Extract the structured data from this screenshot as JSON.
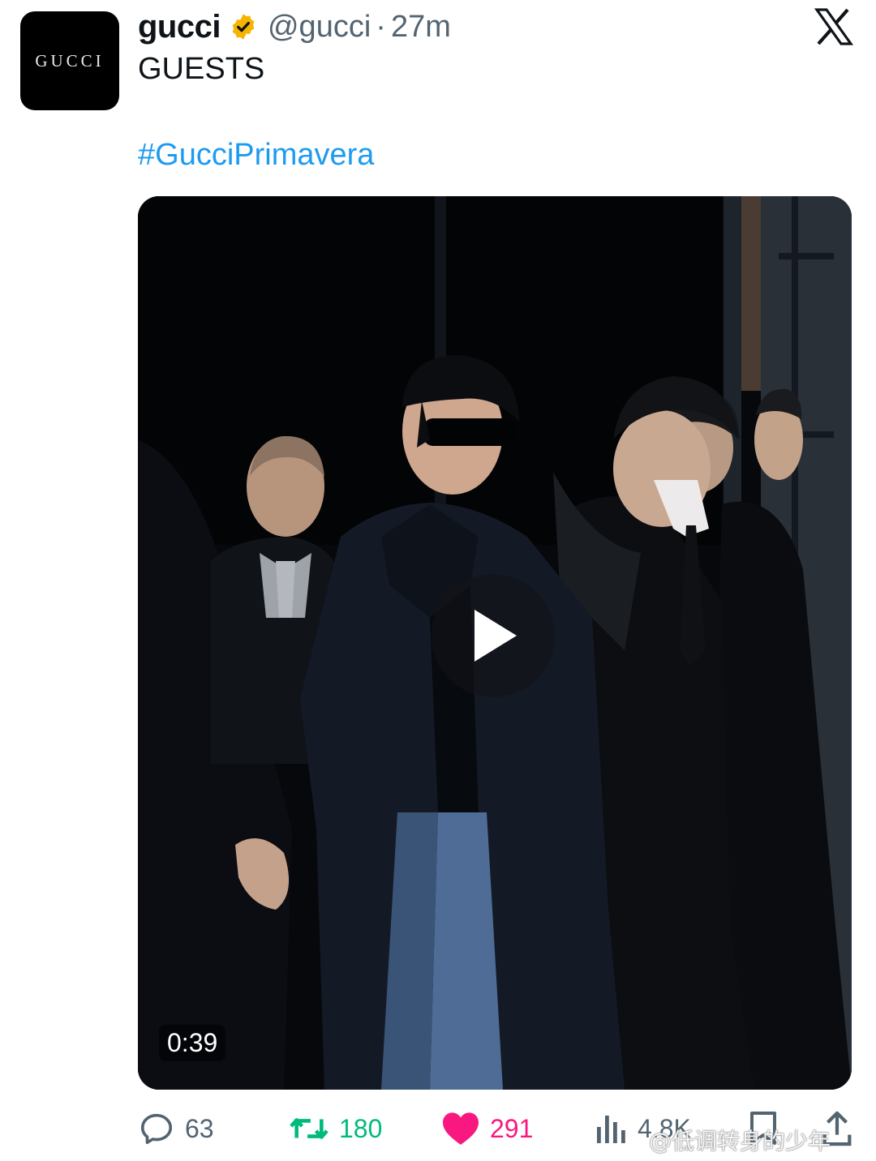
{
  "account": {
    "avatar_text": "GUCCI",
    "display_name": "gucci",
    "handle": "@gucci",
    "separator": "·",
    "time": "27m",
    "verified_icon": "verified-badge-icon",
    "verified_color": "#f4b400"
  },
  "platform_icon": "x-logo-icon",
  "tweet": {
    "text": "GUESTS",
    "hashtag": "#GucciPrimavera",
    "hashtag_color": "#1d9bf0"
  },
  "media": {
    "type": "video",
    "duration": "0:39",
    "play_icon": "play-icon"
  },
  "actions": {
    "reply": {
      "icon": "reply-icon",
      "count": "63"
    },
    "retweet": {
      "icon": "retweet-icon",
      "count": "180",
      "color": "#00ba7c"
    },
    "like": {
      "icon": "heart-icon",
      "count": "291",
      "color": "#f91880"
    },
    "views": {
      "icon": "views-icon",
      "count": "4.8K"
    },
    "bookmark": {
      "icon": "bookmark-icon"
    },
    "share": {
      "icon": "share-icon"
    }
  },
  "watermark": "@低调转身的少年"
}
